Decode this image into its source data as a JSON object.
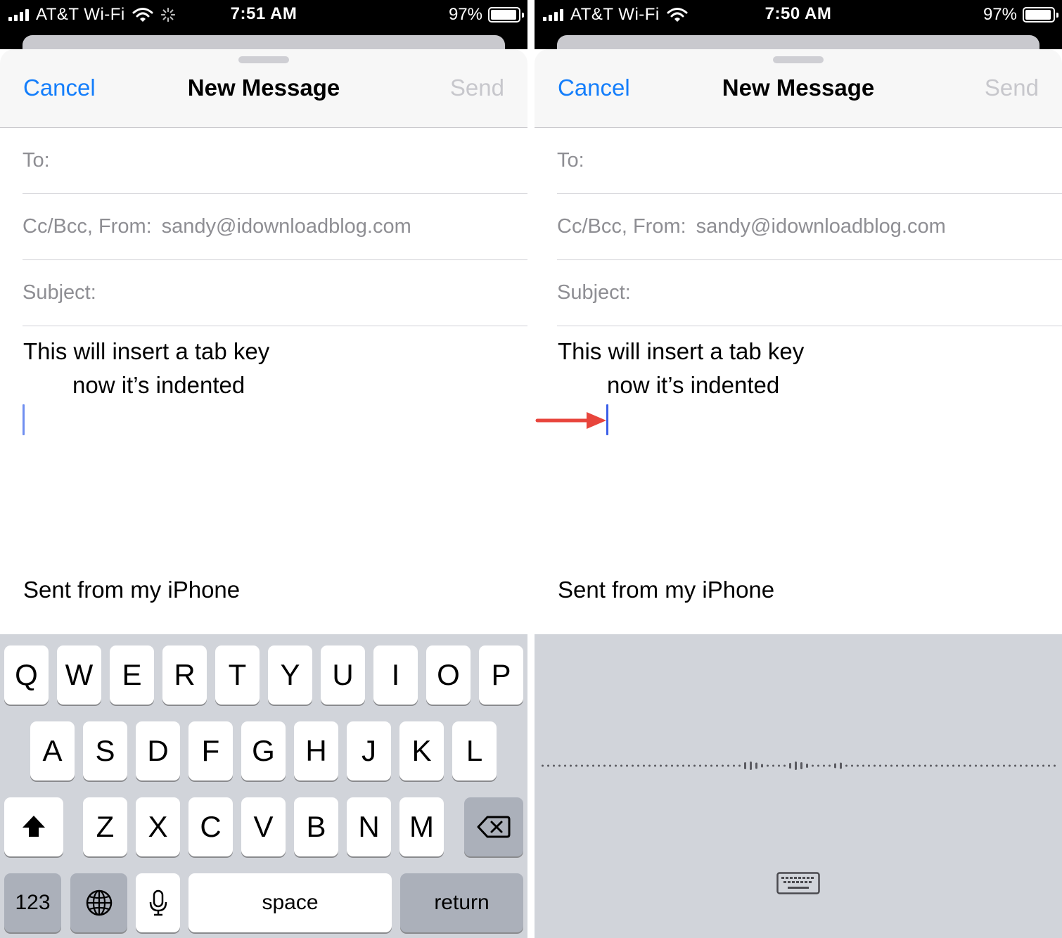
{
  "panels": [
    {
      "status": {
        "carrier": "AT&T Wi-Fi",
        "time": "7:51 AM",
        "battery": "97%",
        "icons": [
          "signal-icon",
          "wifi-icon",
          "activity-spinner-icon",
          "battery-icon"
        ]
      },
      "compose": {
        "cancel": "Cancel",
        "title": "New Message",
        "send": "Send",
        "to_label": "To:",
        "cc_from_label": "Cc/Bcc, From:",
        "from_value": "sandy@idownloadblog.com",
        "subject_label": "Subject:",
        "body_line_1": "This will insert a tab key",
        "body_line_2": "now it’s indented",
        "signature": "Sent from my iPhone"
      },
      "keyboard": {
        "row1": [
          "Q",
          "W",
          "E",
          "R",
          "T",
          "Y",
          "U",
          "I",
          "O",
          "P"
        ],
        "row2": [
          "A",
          "S",
          "D",
          "F",
          "G",
          "H",
          "J",
          "K",
          "L"
        ],
        "row3": [
          "Z",
          "X",
          "C",
          "V",
          "B",
          "N",
          "M"
        ],
        "numbers": "123",
        "space": "space",
        "return": "return",
        "icons": [
          "shift-icon",
          "delete-icon",
          "globe-icon",
          "microphone-icon"
        ]
      }
    },
    {
      "status": {
        "carrier": "AT&T Wi-Fi",
        "time": "7:50 AM",
        "battery": "97%",
        "icons": [
          "signal-icon",
          "wifi-icon",
          "battery-icon"
        ]
      },
      "compose": {
        "cancel": "Cancel",
        "title": "New Message",
        "send": "Send",
        "to_label": "To:",
        "cc_from_label": "Cc/Bcc, From:",
        "from_value": "sandy@idownloadblog.com",
        "subject_label": "Subject:",
        "body_line_1": "This will insert a tab key",
        "body_line_2": "now it’s indented",
        "signature": "Sent from my iPhone"
      },
      "dictation": {
        "icons": [
          "dictation-waveform-icon",
          "keyboard-icon"
        ]
      },
      "annotation": {
        "arrow_color": "#e8453c",
        "icon": "red-arrow-icon"
      }
    }
  ],
  "colors": {
    "accent": "#147efb",
    "disabled": "#c7c7cc",
    "placeholder": "#8e8e93",
    "keyboard_bg": "#d1d4da"
  }
}
